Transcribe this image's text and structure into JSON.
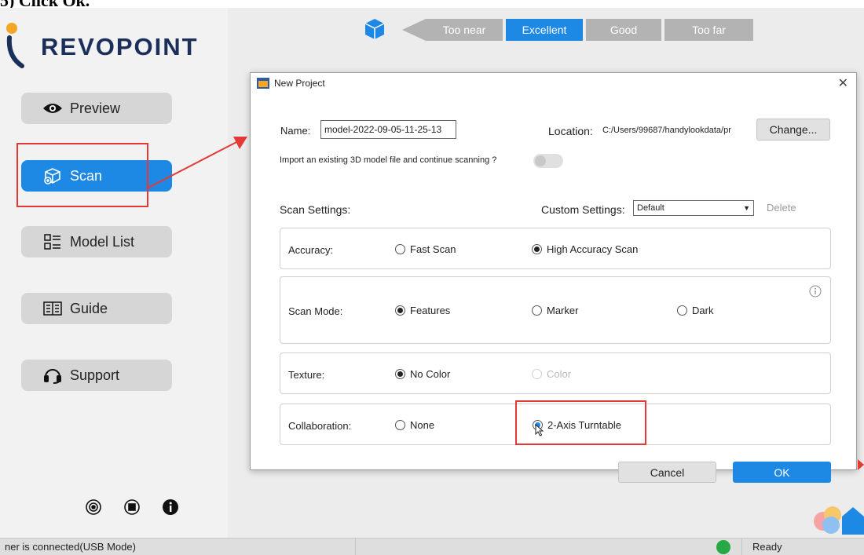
{
  "caption": "5) Click Ok.",
  "brand": {
    "name": "REVOPOINT"
  },
  "sidebar": {
    "items": [
      {
        "label": "Preview",
        "icon": "eye-icon"
      },
      {
        "label": "Scan",
        "icon": "scan-icon",
        "active": true
      },
      {
        "label": "Model List",
        "icon": "list-icon"
      },
      {
        "label": "Guide",
        "icon": "book-icon"
      },
      {
        "label": "Support",
        "icon": "headset-icon"
      }
    ],
    "bottom_icons": [
      "settings-icon",
      "device-icon",
      "info-icon"
    ]
  },
  "distance": {
    "labels": [
      "Too near",
      "Excellent",
      "Good",
      "Too far"
    ],
    "selected": "Excellent"
  },
  "dialog": {
    "title": "New Project",
    "name_label": "Name:",
    "name_value": "model-2022-09-05-11-25-13",
    "location_label": "Location:",
    "location_value": "C:/Users/99687/handylookdata/pr",
    "change_label": "Change...",
    "import_label": "Import an existing 3D model file and continue scanning ?",
    "scan_settings_label": "Scan Settings:",
    "custom_label": "Custom Settings:",
    "custom_value": "Default",
    "delete_label": "Delete",
    "accuracy": {
      "label": "Accuracy:",
      "options": [
        "Fast Scan",
        "High Accuracy Scan"
      ],
      "selected": "High Accuracy Scan"
    },
    "scan_mode": {
      "label": "Scan Mode:",
      "options": [
        "Features",
        "Marker",
        "Dark"
      ],
      "selected": "Features"
    },
    "texture": {
      "label": "Texture:",
      "options": [
        "No Color",
        "Color"
      ],
      "selected": "No Color"
    },
    "collaboration": {
      "label": "Collaboration:",
      "options": [
        "None",
        "2-Axis Turntable"
      ],
      "selected": "2-Axis Turntable"
    },
    "cancel_label": "Cancel",
    "ok_label": "OK"
  },
  "status": {
    "left": "ner is connected(USB Mode)",
    "right": "Ready"
  },
  "colors": {
    "accent": "#1e88e5",
    "annotation": "#e53935",
    "brand_text": "#1a2f5a",
    "status_ok": "#27a844"
  }
}
